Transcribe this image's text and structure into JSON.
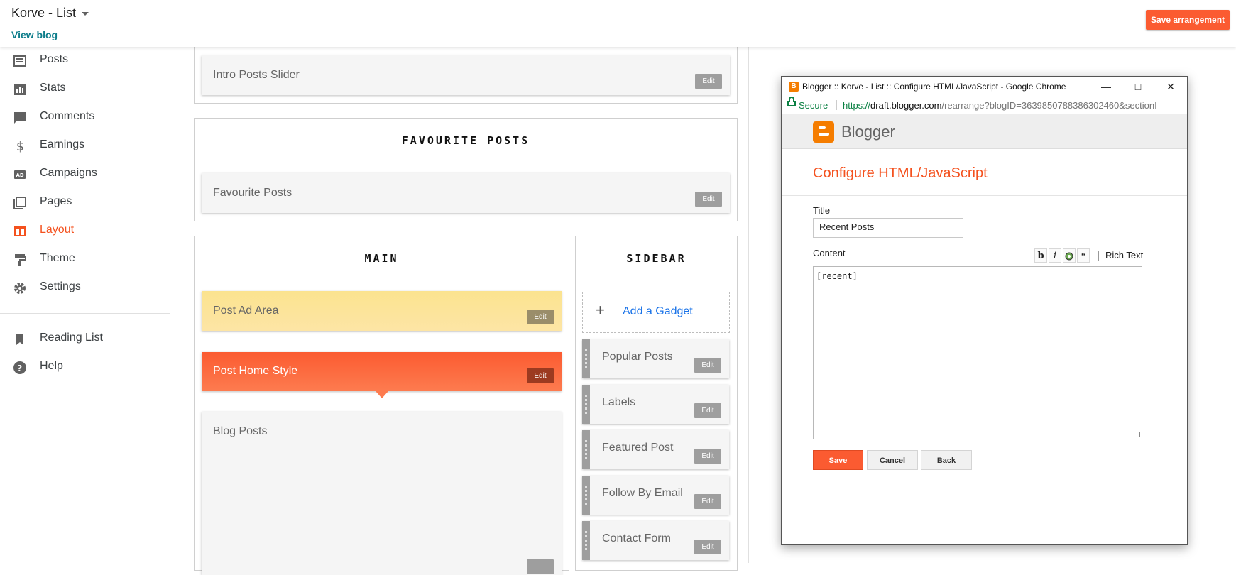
{
  "header": {
    "blog_title": "Korve - List",
    "view_blog": "View blog",
    "save_arrangement": "Save arrangement"
  },
  "nav": {
    "items": [
      {
        "label": "Posts",
        "icon": "posts-icon"
      },
      {
        "label": "Stats",
        "icon": "stats-icon"
      },
      {
        "label": "Comments",
        "icon": "comments-icon"
      },
      {
        "label": "Earnings",
        "icon": "dollar-icon"
      },
      {
        "label": "Campaigns",
        "icon": "ad-icon"
      },
      {
        "label": "Pages",
        "icon": "pages-icon"
      },
      {
        "label": "Layout",
        "icon": "layout-icon",
        "active": true
      },
      {
        "label": "Theme",
        "icon": "paint-roller-icon"
      },
      {
        "label": "Settings",
        "icon": "gear-icon"
      }
    ],
    "secondary": [
      {
        "label": "Reading List",
        "icon": "bookmark-icon"
      },
      {
        "label": "Help",
        "icon": "help-icon"
      }
    ],
    "active_color": "#f4511e"
  },
  "layout": {
    "intro_gadget": {
      "label": "Intro Posts Slider",
      "edit": "Edit"
    },
    "favourite": {
      "heading": "FAVOURITE POSTS",
      "gadget": {
        "label": "Favourite Posts",
        "edit": "Edit"
      }
    },
    "main": {
      "heading": "MAIN",
      "post_ad": {
        "label": "Post Ad Area",
        "edit": "Edit"
      },
      "post_home": {
        "label": "Post Home Style",
        "edit": "Edit"
      },
      "blog_posts": {
        "label": "Blog Posts"
      }
    },
    "sidebar": {
      "heading": "SIDEBAR",
      "add_gadget": "Add a Gadget",
      "gadgets": [
        {
          "label": "Popular Posts",
          "edit": "Edit"
        },
        {
          "label": "Labels",
          "edit": "Edit"
        },
        {
          "label": "Featured Post",
          "edit": "Edit"
        },
        {
          "label": "Follow By Email",
          "edit": "Edit"
        },
        {
          "label": "Contact Form",
          "edit": "Edit"
        }
      ]
    }
  },
  "popup": {
    "window_title": "Blogger :: Korve - List :: Configure HTML/JavaScript - Google Chrome",
    "secure_label": "Secure",
    "url_scheme": "https://",
    "url_host": "draft.blogger.com",
    "url_path": "/rearrange?blogID=3639850788386302460&sectionI",
    "brand": "Blogger",
    "heading": "Configure HTML/JavaScript",
    "title_label": "Title",
    "title_value": "Recent Posts",
    "content_label": "Content",
    "toolbar": {
      "bold": "b",
      "italic": "i",
      "rich_text": "Rich Text"
    },
    "content_value": "[recent]",
    "save": "Save",
    "cancel": "Cancel",
    "back": "Back"
  },
  "colors": {
    "accent": "#fb5b31",
    "link": "#0d7d8b",
    "ad_gradient_top": "#fbe38f",
    "post_home": "#fb5b31"
  }
}
